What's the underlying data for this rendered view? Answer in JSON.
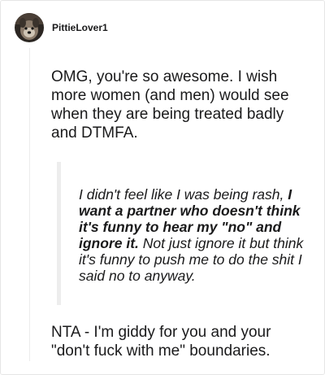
{
  "post": {
    "username": "PittieLover1",
    "avatar_icon": "avatar-dog-photo",
    "paragraph1": "OMG, you're so awesome. I wish more women (and men) would see when they are being treated badly and DTMFA.",
    "quote": {
      "part1": "I didn't feel like I was being rash, ",
      "part2_bold": "I want a partner who doesn't think it's funny to hear my \"no\" and ignore it.",
      "part3": " Not just ignore it but think it's funny to push me to do the shit I said no to anyway."
    },
    "paragraph2": "NTA - I'm giddy for you and your \"don't fuck with me\" boundaries."
  },
  "colors": {
    "text": "#1a1a1b",
    "border": "#e6e6e6",
    "quote_bar": "#ededed",
    "background": "#ffffff"
  }
}
